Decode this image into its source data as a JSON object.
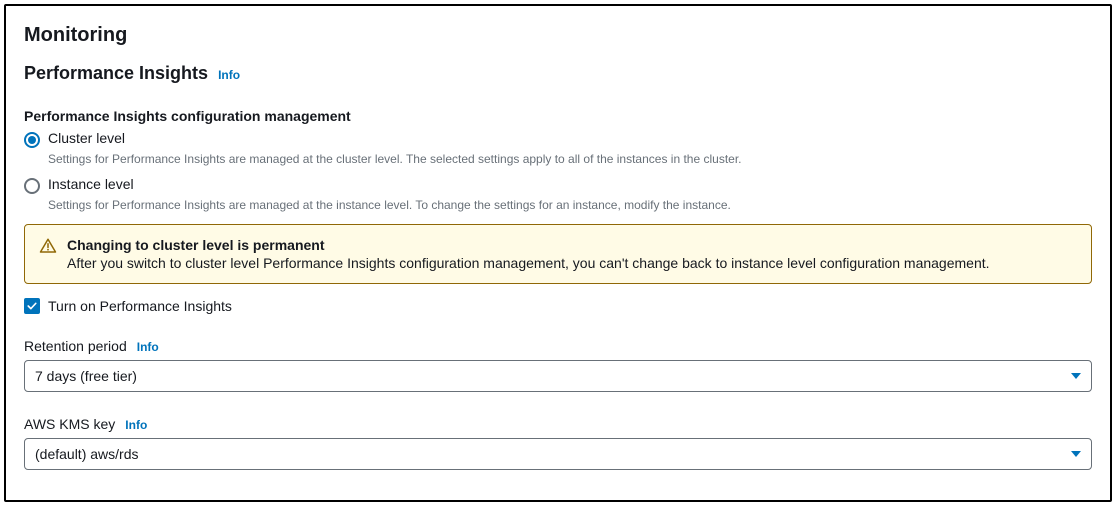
{
  "page": {
    "title": "Monitoring"
  },
  "section": {
    "title": "Performance Insights",
    "info": "Info"
  },
  "configMgmt": {
    "label": "Performance Insights configuration management",
    "options": [
      {
        "label": "Cluster level",
        "description": "Settings for Performance Insights are managed at the cluster level. The selected settings apply to all of the instances in the cluster.",
        "selected": true
      },
      {
        "label": "Instance level",
        "description": "Settings for Performance Insights are managed at the instance level. To change the settings for an instance, modify the instance.",
        "selected": false
      }
    ]
  },
  "alert": {
    "title": "Changing to cluster level is permanent",
    "text": "After you switch to cluster level Performance Insights configuration management, you can't change back to instance level configuration management."
  },
  "enable": {
    "label": "Turn on Performance Insights",
    "checked": true
  },
  "retention": {
    "label": "Retention period",
    "info": "Info",
    "value": "7 days (free tier)"
  },
  "kms": {
    "label": "AWS KMS key",
    "info": "Info",
    "value": "(default) aws/rds"
  }
}
